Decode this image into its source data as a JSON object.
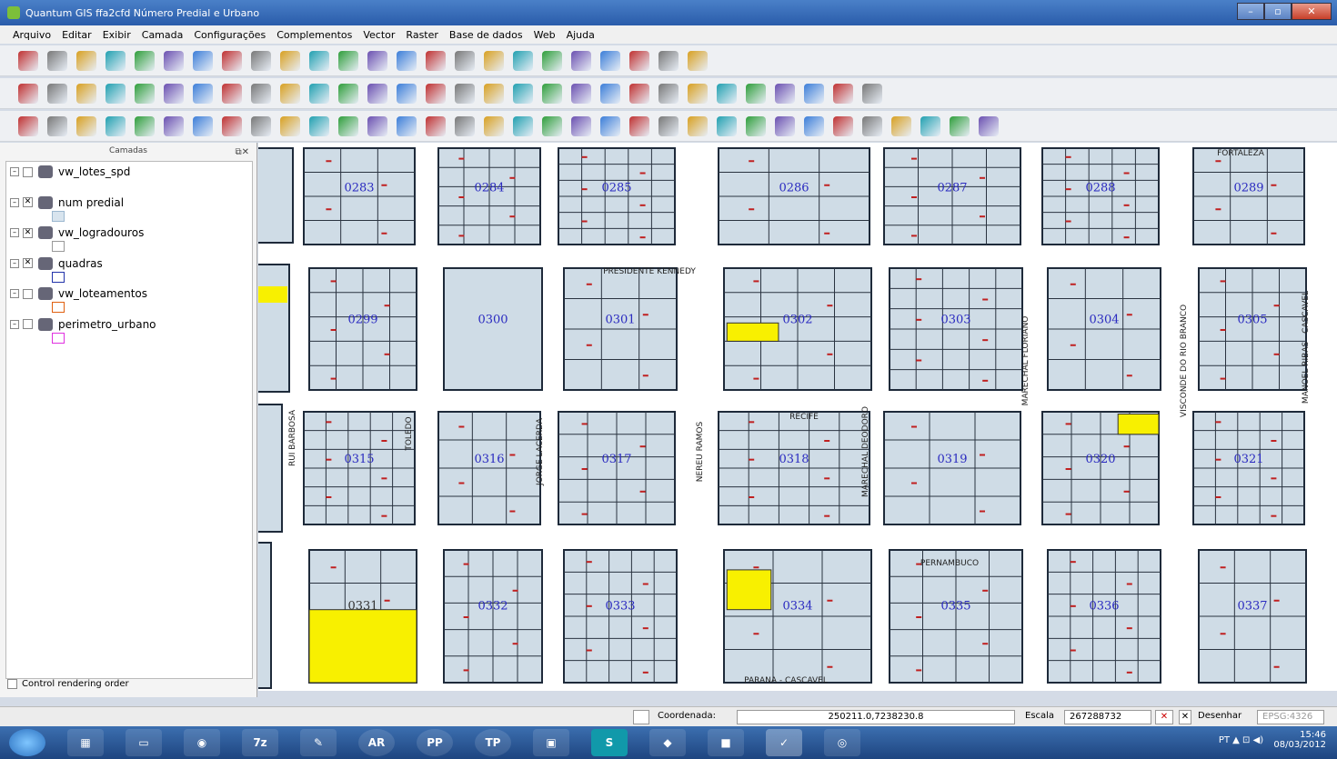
{
  "window": {
    "title": "Quantum GIS ffa2cfd   Número Predial e Urbano"
  },
  "menu": [
    "Arquivo",
    "Editar",
    "Exibir",
    "Camada",
    "Configurações",
    "Complementos",
    "Vector",
    "Raster",
    "Base de dados",
    "Web",
    "Ajuda"
  ],
  "panel": {
    "title": "Camadas",
    "control_rendering": "Control rendering order"
  },
  "layers": [
    {
      "name": "vw_lotes_spd",
      "checked": false,
      "symbol_color": "#aac"
    },
    {
      "name": "num predial",
      "checked": true,
      "symbol_color": "#9cb8d0"
    },
    {
      "name": "vw_logradouros",
      "checked": true,
      "symbol_color": "#999"
    },
    {
      "name": "quadras",
      "checked": true,
      "symbol_color": "#2233aa"
    },
    {
      "name": "vw_loteamentos",
      "checked": false,
      "symbol_color": "#e06010"
    },
    {
      "name": "perimetro_urbano",
      "checked": false,
      "symbol_color": "#e030e0"
    }
  ],
  "map": {
    "parcel_color": "#cfdce6",
    "highlight_color": "#f8f000",
    "block_ids": [
      "0283",
      "0284",
      "0285",
      "0286",
      "0287",
      "0288",
      "0289",
      "0299",
      "0300",
      "0301",
      "0302",
      "0303",
      "0304",
      "0305",
      "0315",
      "0316",
      "0317",
      "0318",
      "0319",
      "0320",
      "0321",
      "0331",
      "0332",
      "0333",
      "0334",
      "0335",
      "0336",
      "0337"
    ],
    "streets_h": [
      "FORTALEZA",
      "PRESIDENTE KENNEDY",
      "RECIFE",
      "PERNAMBUCO",
      "PARANA - CASCAVEL"
    ],
    "streets_v": [
      "RUI BARBOSA",
      "TOLEDO",
      "JORGE LACERDA",
      "NEREU RAMOS",
      "MARECHAL DEODORO",
      "MARECHAL FLORIANO",
      "VISCONDE DO RIO BRANCO",
      "MANOEL RIBAS - CASCAVEL"
    ]
  },
  "status": {
    "coord_label": "Coordenada:",
    "coord_value": "250211.0,7238230.8",
    "scale_label": "Escala",
    "scale_value": "267288732",
    "render_label": "Desenhar",
    "epsg": "EPSG:4326"
  },
  "taskbar": {
    "apps": [
      "AR",
      "PP",
      "TP",
      "S"
    ],
    "lang": "PT",
    "time": "15:46",
    "date": "08/03/2012"
  }
}
